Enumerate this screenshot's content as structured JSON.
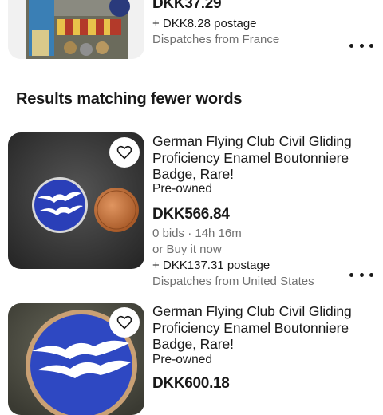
{
  "top_item": {
    "price": "DKK37.29",
    "postage": "+ DKK8.28 postage",
    "dispatch": "Dispatches from France"
  },
  "section": {
    "heading": "Results matching fewer words"
  },
  "items": [
    {
      "title": "German Flying Club Civil Gliding Proficiency Enamel Boutonniere Badge, Rare!",
      "condition": "Pre-owned",
      "price": "DKK566.84",
      "bids": "0 bids · 14h 16m",
      "buy_it_now": "or Buy it now",
      "postage": "+ DKK137.31 postage",
      "dispatch": "Dispatches from United States"
    },
    {
      "title": "German Flying Club Civil Gliding Proficiency Enamel Boutonniere Badge, Rare!",
      "condition": "Pre-owned",
      "price": "DKK600.18"
    }
  ],
  "icons": {
    "heart": "heart-outline-icon",
    "more": "more-dots-icon"
  },
  "colors": {
    "text": "#191919",
    "secondary_text": "#707070",
    "badge_blue": "#2a3fb8",
    "coin": "#c8733a"
  }
}
